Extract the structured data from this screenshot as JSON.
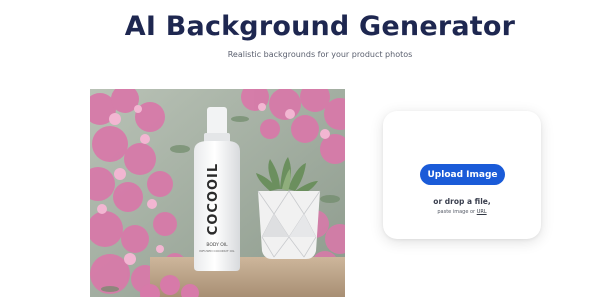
{
  "header": {
    "title": "AI Background Generator",
    "subtitle": "Realistic backgrounds for your product photos"
  },
  "product_photo": {
    "brand_text": "COCOOIL",
    "product_line": "BODY OIL",
    "ingredient_line": "INFUSED COCONUT OIL"
  },
  "upload": {
    "button_label": "Upload Image",
    "drop_text": "or drop a file,",
    "paste_text": "paste image or",
    "url_label": "URL",
    "accent_color": "#1a5bd8"
  }
}
